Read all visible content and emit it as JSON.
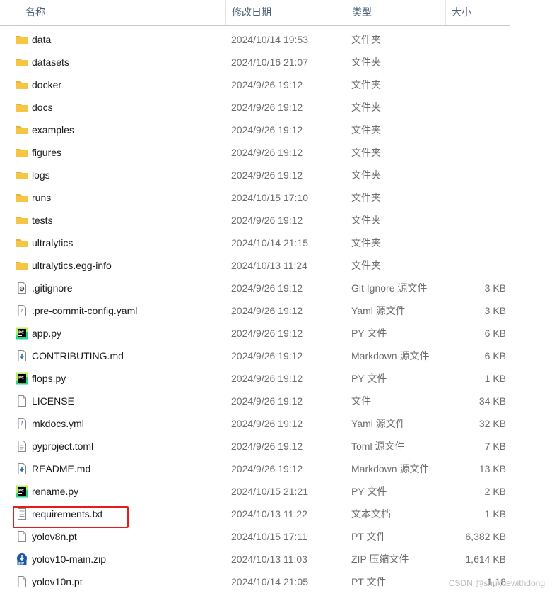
{
  "columns": {
    "name": "名称",
    "date": "修改日期",
    "type": "类型",
    "size": "大小"
  },
  "files": [
    {
      "icon": "folder-icon",
      "name": "data",
      "date": "2024/10/14 19:53",
      "type": "文件夹",
      "size": ""
    },
    {
      "icon": "folder-icon",
      "name": "datasets",
      "date": "2024/10/16 21:07",
      "type": "文件夹",
      "size": ""
    },
    {
      "icon": "folder-icon",
      "name": "docker",
      "date": "2024/9/26 19:12",
      "type": "文件夹",
      "size": ""
    },
    {
      "icon": "folder-icon",
      "name": "docs",
      "date": "2024/9/26 19:12",
      "type": "文件夹",
      "size": ""
    },
    {
      "icon": "folder-icon",
      "name": "examples",
      "date": "2024/9/26 19:12",
      "type": "文件夹",
      "size": ""
    },
    {
      "icon": "folder-icon",
      "name": "figures",
      "date": "2024/9/26 19:12",
      "type": "文件夹",
      "size": ""
    },
    {
      "icon": "folder-icon",
      "name": "logs",
      "date": "2024/9/26 19:12",
      "type": "文件夹",
      "size": ""
    },
    {
      "icon": "folder-icon",
      "name": "runs",
      "date": "2024/10/15 17:10",
      "type": "文件夹",
      "size": ""
    },
    {
      "icon": "folder-icon",
      "name": "tests",
      "date": "2024/9/26 19:12",
      "type": "文件夹",
      "size": ""
    },
    {
      "icon": "folder-icon",
      "name": "ultralytics",
      "date": "2024/10/14 21:15",
      "type": "文件夹",
      "size": ""
    },
    {
      "icon": "folder-icon",
      "name": "ultralytics.egg-info",
      "date": "2024/10/13 11:24",
      "type": "文件夹",
      "size": ""
    },
    {
      "icon": "gitignore-file-icon",
      "name": ".gitignore",
      "date": "2024/9/26 19:12",
      "type": "Git Ignore 源文件",
      "size": "3 KB"
    },
    {
      "icon": "yaml-file-icon",
      "name": ".pre-commit-config.yaml",
      "date": "2024/9/26 19:12",
      "type": "Yaml 源文件",
      "size": "3 KB"
    },
    {
      "icon": "pycharm-file-icon",
      "name": "app.py",
      "date": "2024/9/26 19:12",
      "type": "PY 文件",
      "size": "6 KB"
    },
    {
      "icon": "markdown-file-icon",
      "name": "CONTRIBUTING.md",
      "date": "2024/9/26 19:12",
      "type": "Markdown 源文件",
      "size": "6 KB"
    },
    {
      "icon": "pycharm-file-icon",
      "name": "flops.py",
      "date": "2024/9/26 19:12",
      "type": "PY 文件",
      "size": "1 KB"
    },
    {
      "icon": "blank-file-icon",
      "name": "LICENSE",
      "date": "2024/9/26 19:12",
      "type": "文件",
      "size": "34 KB"
    },
    {
      "icon": "yaml-file-icon",
      "name": "mkdocs.yml",
      "date": "2024/9/26 19:12",
      "type": "Yaml 源文件",
      "size": "32 KB"
    },
    {
      "icon": "toml-file-icon",
      "name": "pyproject.toml",
      "date": "2024/9/26 19:12",
      "type": "Toml 源文件",
      "size": "7 KB"
    },
    {
      "icon": "markdown-file-icon",
      "name": "README.md",
      "date": "2024/9/26 19:12",
      "type": "Markdown 源文件",
      "size": "13 KB"
    },
    {
      "icon": "pycharm-file-icon",
      "name": "rename.py",
      "date": "2024/10/15 21:21",
      "type": "PY 文件",
      "size": "2 KB"
    },
    {
      "icon": "text-file-icon",
      "name": "requirements.txt",
      "date": "2024/10/13 11:22",
      "type": "文本文档",
      "size": "1 KB"
    },
    {
      "icon": "blank-file-icon",
      "name": "yolov8n.pt",
      "date": "2024/10/15 17:11",
      "type": "PT 文件",
      "size": "6,382 KB"
    },
    {
      "icon": "zip-file-icon",
      "name": "yolov10-main.zip",
      "date": "2024/10/13 11:03",
      "type": "ZIP 压缩文件",
      "size": "1,614 KB"
    },
    {
      "icon": "blank-file-icon",
      "name": "yolov10n.pt",
      "date": "2024/10/14 21:05",
      "type": "PT 文件",
      "size": "1,18"
    }
  ],
  "watermark": "CSDN @shuxuewithdong",
  "colors": {
    "folder": "#f7c544",
    "highlight": "#e51c1c",
    "pycharm": "#21d789"
  }
}
